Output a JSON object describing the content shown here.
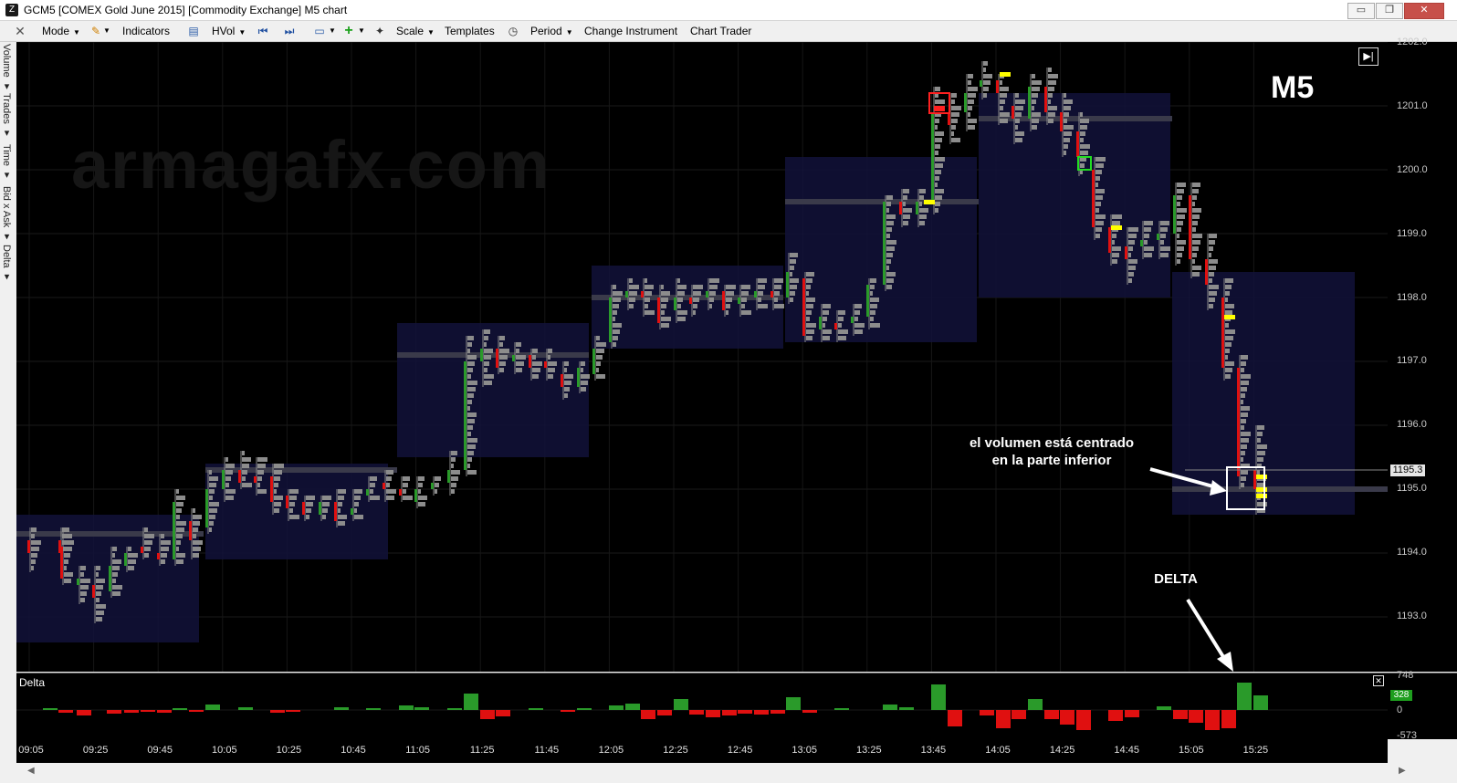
{
  "window": {
    "title": "GCM5 [COMEX Gold June 2015] [Commodity Exchange] M5 chart",
    "buttons": [
      "▭",
      "❐",
      "✕"
    ]
  },
  "toolbar": {
    "mode": "Mode",
    "indicators": "Indicators",
    "hvol": "HVol",
    "scale": "Scale",
    "templates": "Templates",
    "period": "Period",
    "change_instrument": "Change Instrument",
    "chart_trader": "Chart Trader"
  },
  "side_tabs": [
    "Volume",
    "Trades",
    "Time",
    "Bid x Ask",
    "Delta"
  ],
  "chart": {
    "watermark": "armagafx.com",
    "timeframe_badge": "M5",
    "annotation_volume": [
      "el volumen está centrado",
      "en la parte inferior"
    ],
    "annotation_delta": "DELTA",
    "current_price": "1195.3",
    "price_labels": [
      "1202.0",
      "1201.0",
      "1200.0",
      "1199.0",
      "1198.0",
      "1197.0",
      "1196.0",
      "1195.0",
      "1194.0",
      "1193.0"
    ],
    "time_labels": [
      "09:05",
      "09:25",
      "09:45",
      "10:05",
      "10:25",
      "10:45",
      "11:05",
      "11:25",
      "11:45",
      "12:05",
      "12:25",
      "12:45",
      "13:05",
      "13:25",
      "13:45",
      "14:05",
      "14:25",
      "14:45",
      "15:05",
      "15:25"
    ]
  },
  "delta_panel": {
    "title": "Delta",
    "axis_labels": [
      "748",
      "0",
      "-573"
    ],
    "current_value": "328"
  },
  "colors": {
    "up": "#2a9a2a",
    "down": "#e01010",
    "poc": "#ffff00",
    "neutral": "#8c8c8c",
    "profile": "#12123a"
  }
}
